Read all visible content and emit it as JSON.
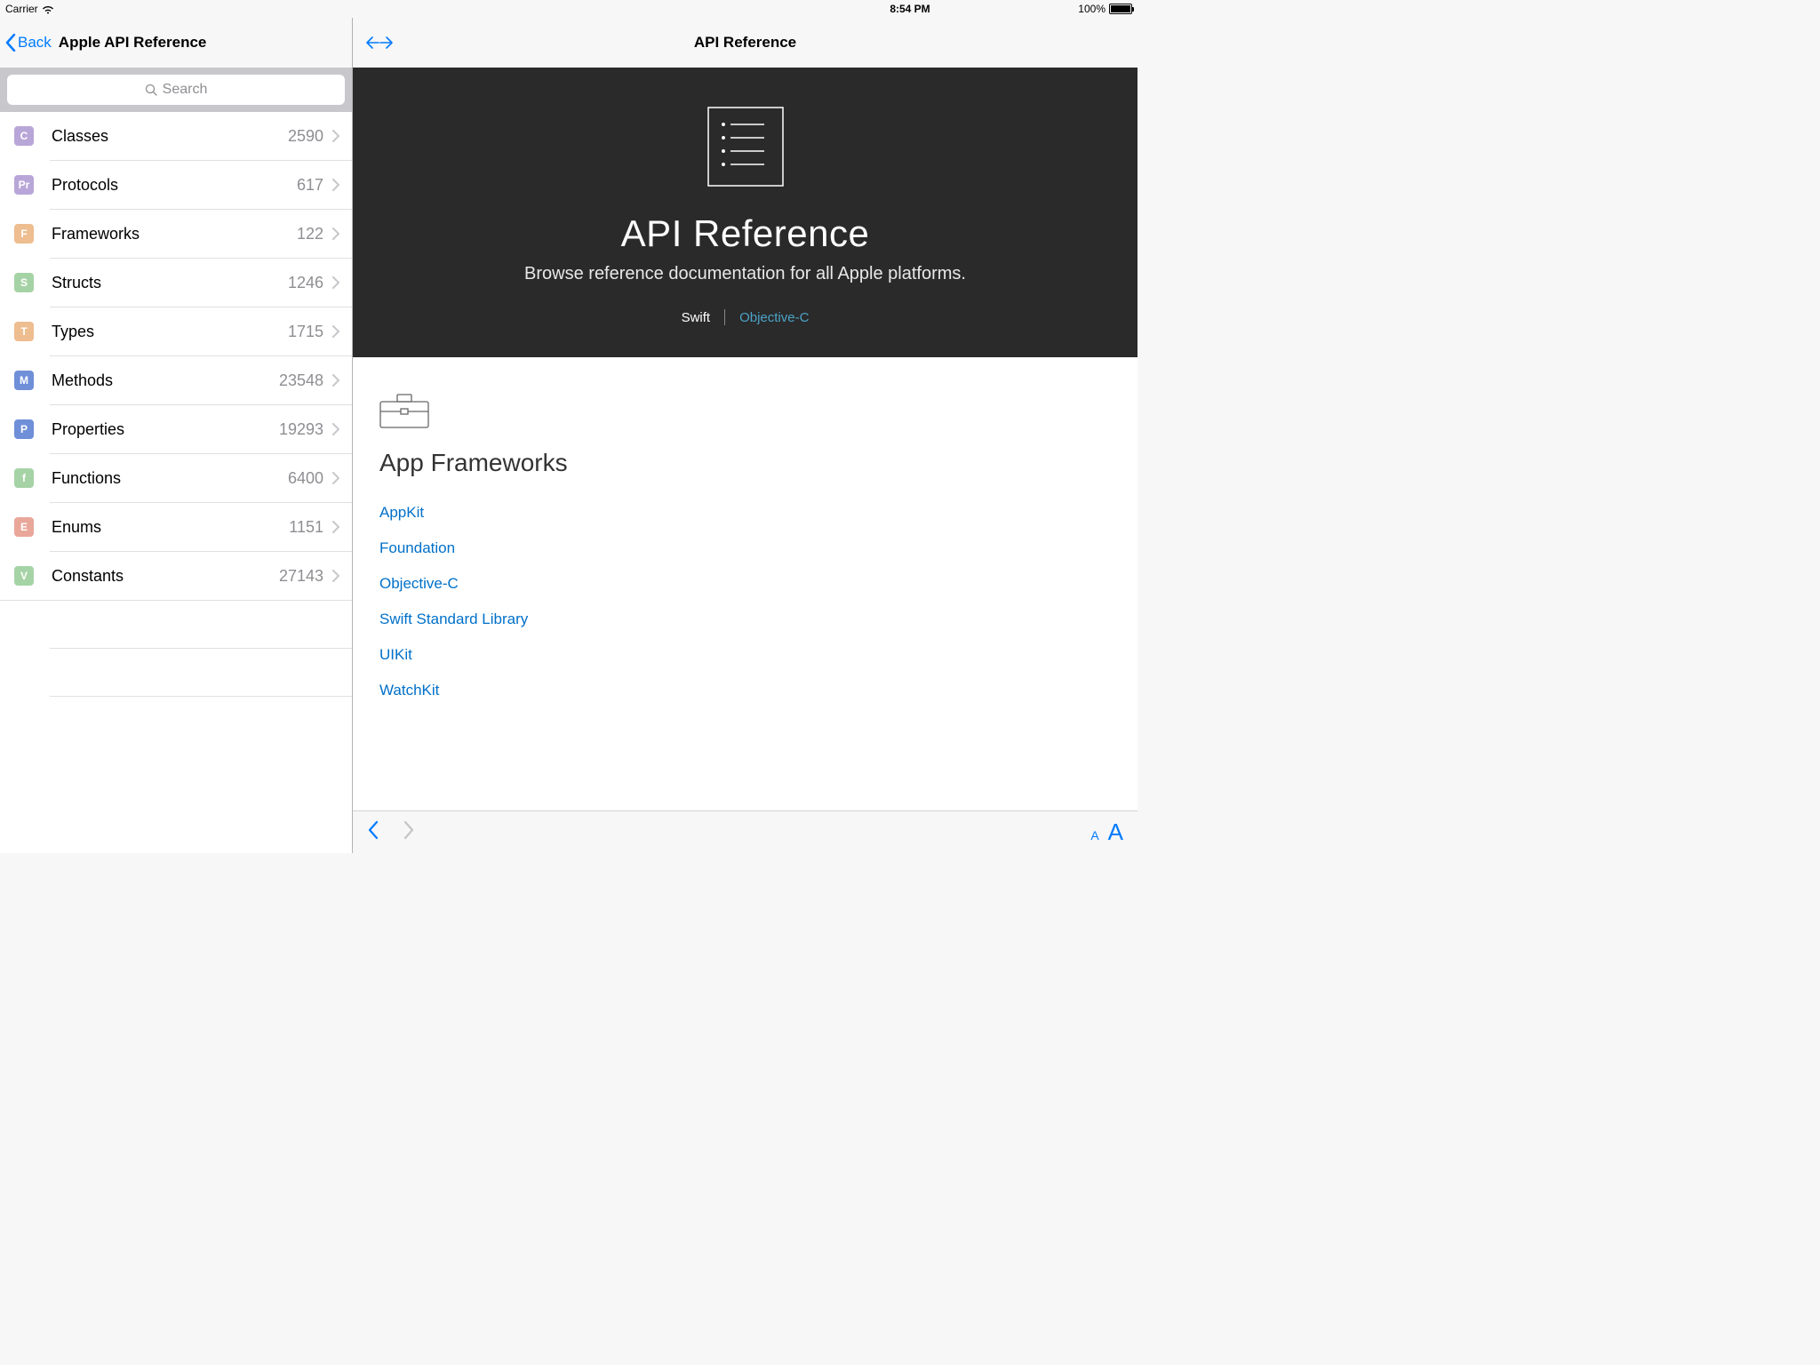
{
  "statusbar": {
    "carrier": "Carrier",
    "time": "8:54 PM",
    "battery": "100%"
  },
  "sidebar": {
    "back_label": "Back",
    "title": "Apple API Reference",
    "search_placeholder": "Search",
    "items": [
      {
        "glyph": "C",
        "bg": "#b9a6d8",
        "label": "Classes",
        "count": "2590"
      },
      {
        "glyph": "Pr",
        "bg": "#b9a6d8",
        "label": "Protocols",
        "count": "617"
      },
      {
        "glyph": "F",
        "bg": "#eebd90",
        "label": "Frameworks",
        "count": "122"
      },
      {
        "glyph": "S",
        "bg": "#a6d3a6",
        "label": "Structs",
        "count": "1246"
      },
      {
        "glyph": "T",
        "bg": "#eebd90",
        "label": "Types",
        "count": "1715"
      },
      {
        "glyph": "M",
        "bg": "#6f8fd8",
        "label": "Methods",
        "count": "23548"
      },
      {
        "glyph": "P",
        "bg": "#6f8fd8",
        "label": "Properties",
        "count": "19293"
      },
      {
        "glyph": "f",
        "bg": "#a6d3a6",
        "label": "Functions",
        "count": "6400"
      },
      {
        "glyph": "E",
        "bg": "#e9a79a",
        "label": "Enums",
        "count": "1151"
      },
      {
        "glyph": "V",
        "bg": "#a6d3a6",
        "label": "Constants",
        "count": "27143"
      }
    ]
  },
  "content": {
    "title": "API Reference",
    "hero_title": "API Reference",
    "hero_sub": "Browse reference documentation for all Apple platforms.",
    "lang_swift": "Swift",
    "lang_objc": "Objective-C",
    "section_title": "App Frameworks",
    "frameworks": [
      "AppKit",
      "Foundation",
      "Objective-C",
      "Swift Standard Library",
      "UIKit",
      "WatchKit"
    ]
  }
}
